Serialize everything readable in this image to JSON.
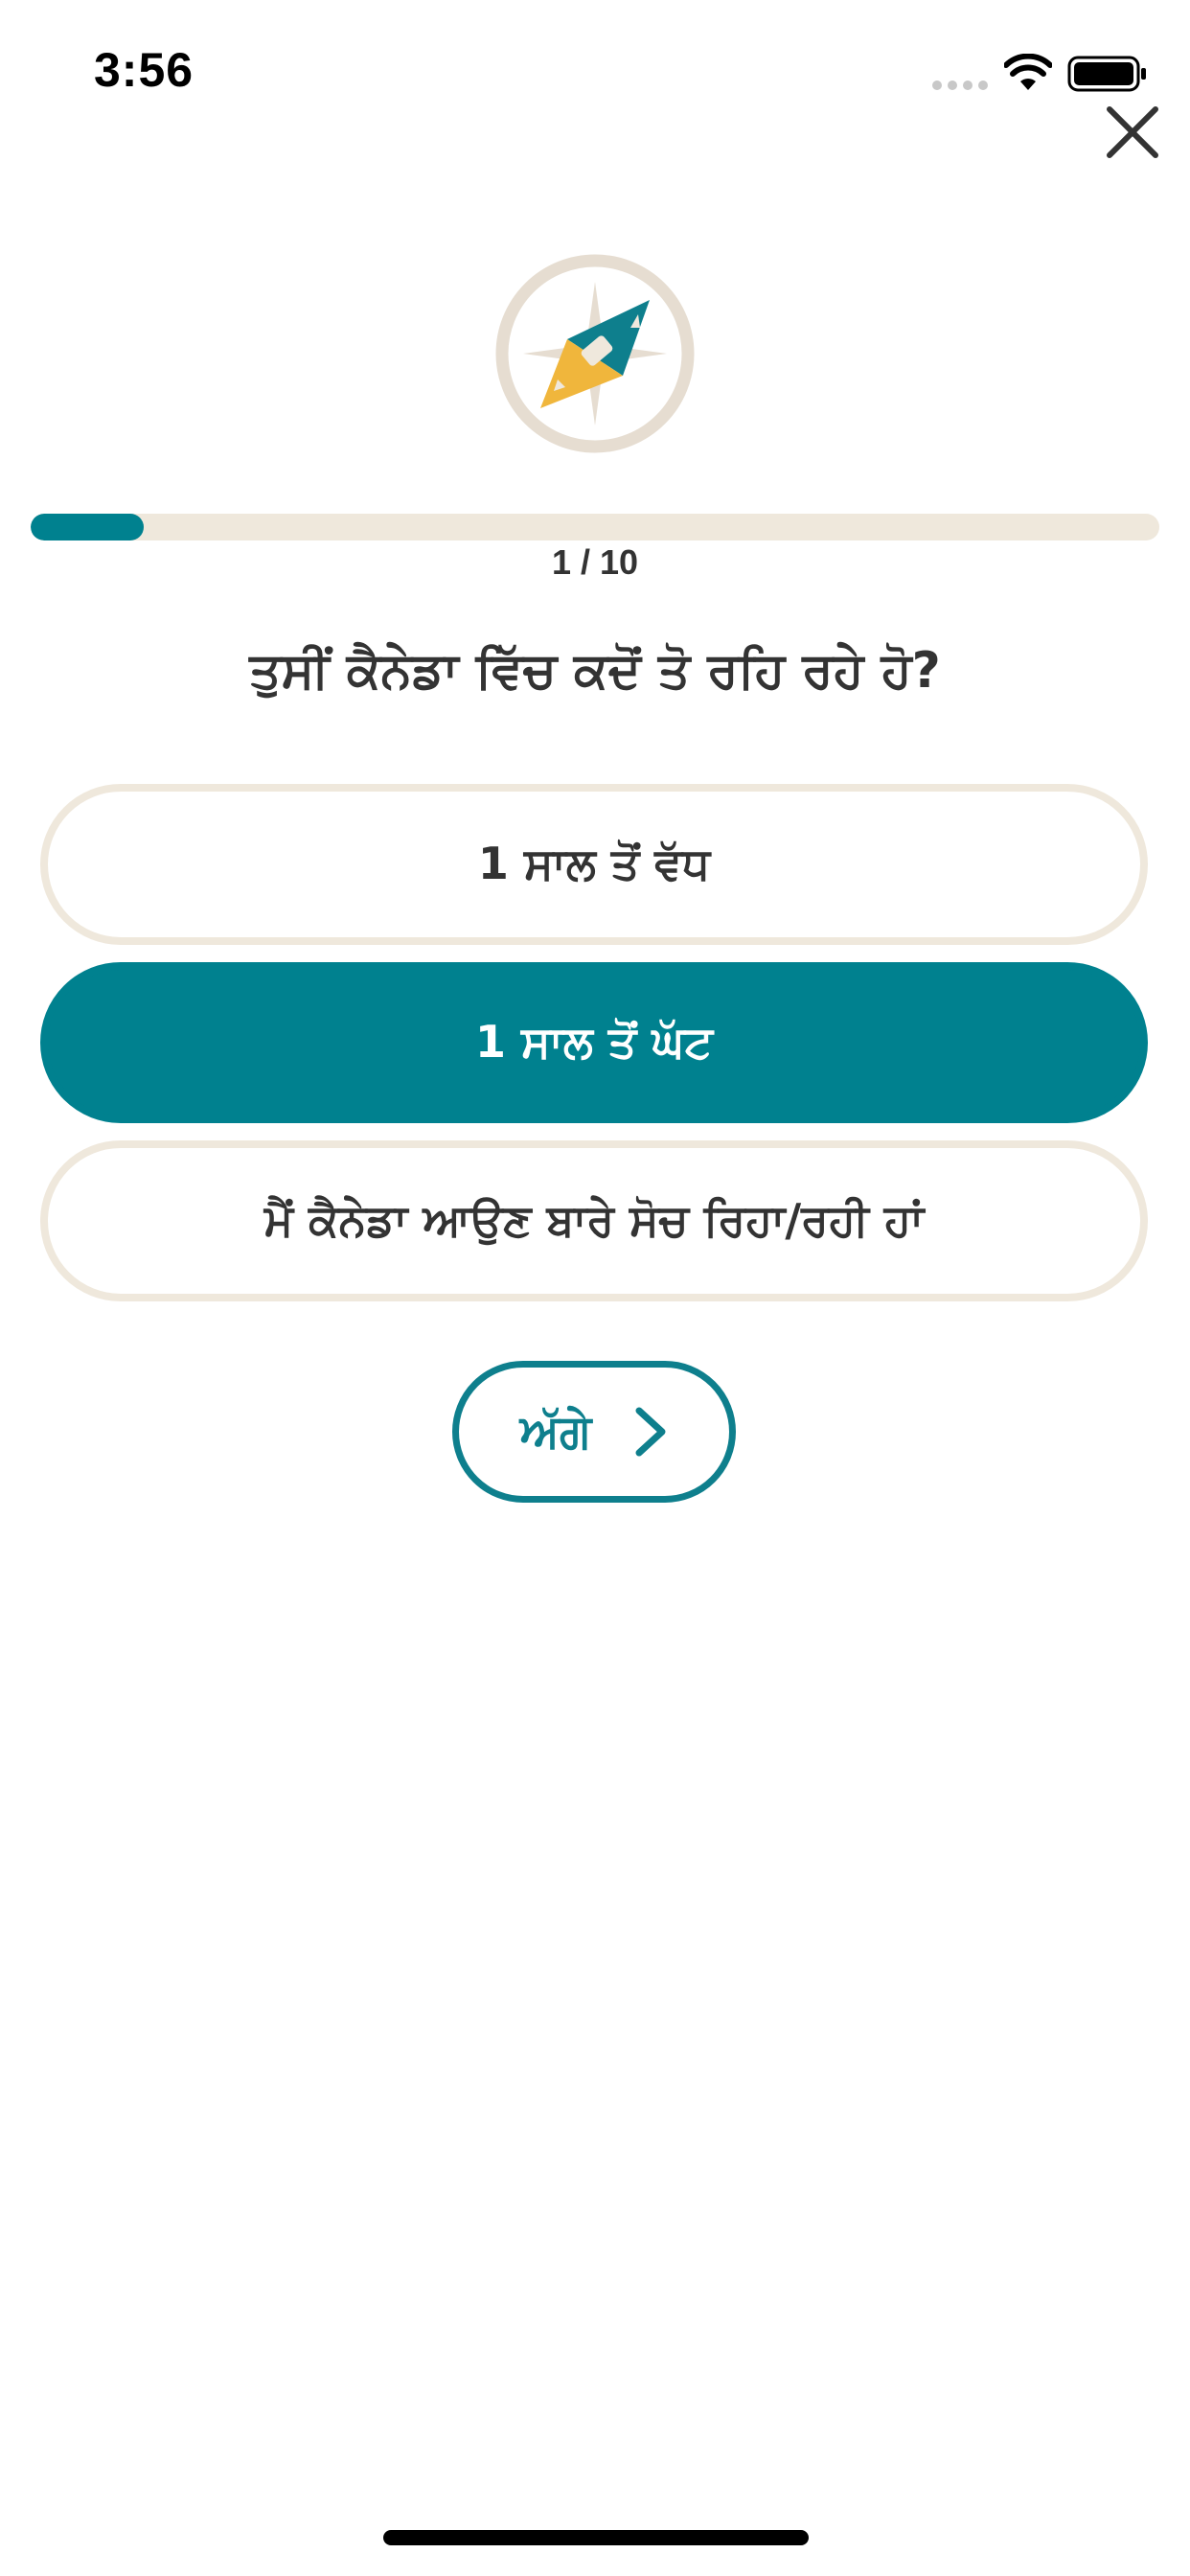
{
  "status_bar": {
    "time": "3:56"
  },
  "header": {
    "close_icon": "close-icon"
  },
  "logo": {
    "icon": "compass-icon",
    "colors": {
      "ring": "#e6ddd1",
      "needle_teal": "#0e7f8d",
      "needle_yellow": "#f0b63c"
    }
  },
  "progress": {
    "current": 1,
    "total": 10,
    "fraction": 0.1,
    "label": "1 / 10"
  },
  "question": {
    "text": "ਤੁਸੀਂ ਕੈਨੇਡਾ ਵਿੱਚ ਕਦੋਂ ਤੋ ਰਹਿ ਰਹੇ ਹੋ?"
  },
  "answers": [
    {
      "label": "1 ਸਾਲ ਤੋਂ ਵੱਧ",
      "selected": false
    },
    {
      "label": "1 ਸਾਲ ਤੋਂ ਘੱਟ",
      "selected": true
    },
    {
      "label": "ਮੈਂ ਕੈਨੇਡਾ ਆਉਣ ਬਾਰੇ ਸੋਚ ਰਿਹਾ/ਰਹੀ ਹਾਂ",
      "selected": false
    }
  ],
  "next_button": {
    "label": "ਅੱਗੇ",
    "icon": "chevron-right-icon"
  },
  "colors": {
    "accent": "#00818f",
    "border_beige": "#efe8dc",
    "text": "#333333"
  }
}
